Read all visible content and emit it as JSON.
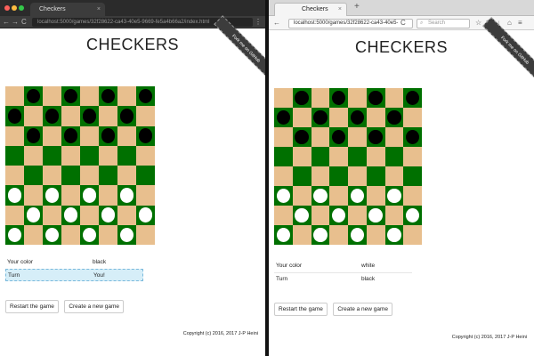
{
  "left": {
    "tab_title": "Checkers",
    "tab_close": "×",
    "nav": {
      "back": "←",
      "forward": "→",
      "reload": "C"
    },
    "url": "localhost:5000/games/32f28622-ca43-40e5-9669-fe5a4b66a2/index.html",
    "page": {
      "title": "CHECKERS",
      "ribbon": "Fork me on GitHub",
      "board": [
        [
          ".",
          "b",
          ".",
          "b",
          ".",
          "b",
          ".",
          "b"
        ],
        [
          "b",
          ".",
          "b",
          ".",
          "b",
          ".",
          "b",
          "."
        ],
        [
          ".",
          "b",
          ".",
          "b",
          ".",
          "b",
          ".",
          "b"
        ],
        [
          ".",
          ".",
          ".",
          ".",
          ".",
          ".",
          ".",
          "."
        ],
        [
          ".",
          ".",
          ".",
          ".",
          ".",
          ".",
          ".",
          "."
        ],
        [
          "w",
          ".",
          "w",
          ".",
          "w",
          ".",
          "w",
          "."
        ],
        [
          ".",
          "w",
          ".",
          "w",
          ".",
          "w",
          ".",
          "w"
        ],
        [
          "w",
          ".",
          "w",
          ".",
          "w",
          ".",
          "w",
          "."
        ]
      ],
      "info": [
        {
          "label": "Your color",
          "value": "black",
          "highlight": false
        },
        {
          "label": "Turn",
          "value": "You!",
          "highlight": true
        }
      ],
      "restart_label": "Restart the game",
      "new_game_label": "Create a new game",
      "copyright": "Copyright (c) 2016, 2017 J-P Heini"
    }
  },
  "right": {
    "tab_title": "Checkers",
    "tab_close": "×",
    "new_tab": "+",
    "nav": {
      "back": "←",
      "reload": "C"
    },
    "url": "localhost:5000/games/32f28622-ca43-40e5-",
    "search_placeholder": "Search",
    "page": {
      "title": "CHECKERS",
      "ribbon": "Fork me on GitHub",
      "board": [
        [
          ".",
          "b",
          ".",
          "b",
          ".",
          "b",
          ".",
          "b"
        ],
        [
          "b",
          ".",
          "b",
          ".",
          "b",
          ".",
          "b",
          "."
        ],
        [
          ".",
          "b",
          ".",
          "b",
          ".",
          "b",
          ".",
          "b"
        ],
        [
          ".",
          ".",
          ".",
          ".",
          ".",
          ".",
          ".",
          "."
        ],
        [
          ".",
          ".",
          ".",
          ".",
          ".",
          ".",
          ".",
          "."
        ],
        [
          "w",
          ".",
          "w",
          ".",
          "w",
          ".",
          "w",
          "."
        ],
        [
          ".",
          "w",
          ".",
          "w",
          ".",
          "w",
          ".",
          "w"
        ],
        [
          "w",
          ".",
          "w",
          ".",
          "w",
          ".",
          "w",
          "."
        ]
      ],
      "info": [
        {
          "label": "Your color",
          "value": "white",
          "highlight": false
        },
        {
          "label": "Turn",
          "value": "black",
          "highlight": false
        }
      ],
      "restart_label": "Restart the game",
      "new_game_label": "Create a new game",
      "copyright": "Copyright (c) 2016, 2017 J-P Heini"
    }
  },
  "colors": {
    "board_light": "#e8bf8e",
    "board_dark": "#007000",
    "piece_black": "#000000",
    "piece_white": "#ffffff",
    "turn_highlight": "#d6eef8"
  }
}
